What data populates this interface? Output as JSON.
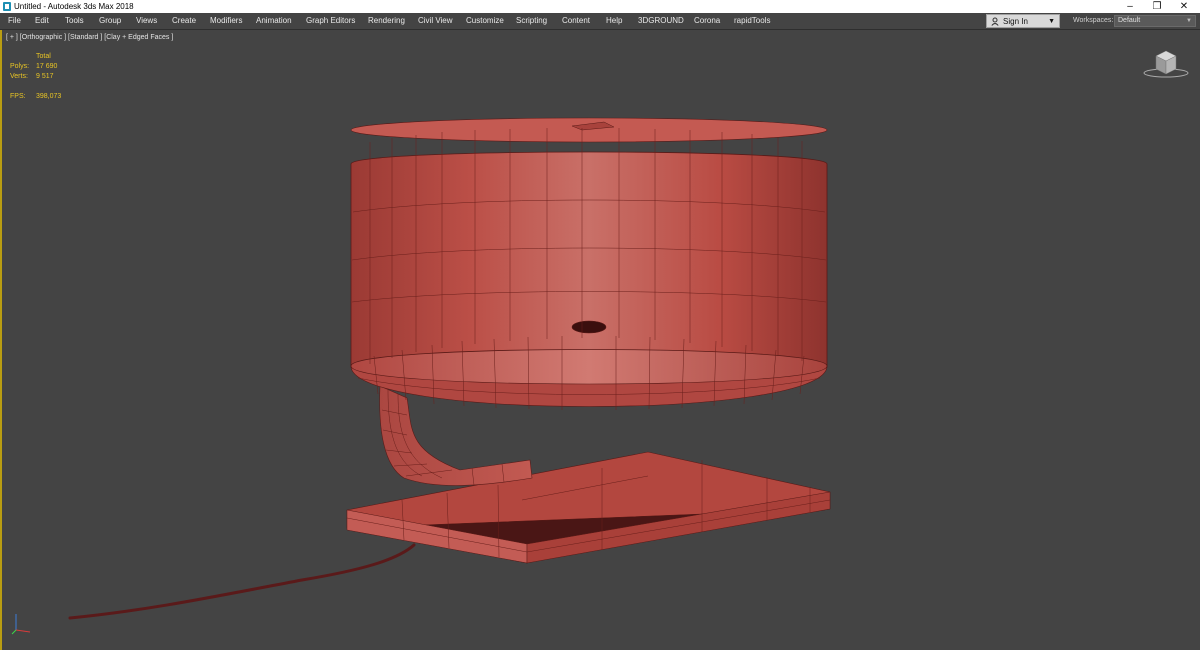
{
  "window": {
    "title": "Untitled - Autodesk 3ds Max 2018",
    "controls": [
      "minimize-icon",
      "restore-icon",
      "close-icon"
    ]
  },
  "menu": {
    "items": [
      "File",
      "Edit",
      "Tools",
      "Group",
      "Views",
      "Create",
      "Modifiers",
      "Animation",
      "Graph Editors",
      "Rendering",
      "Civil View",
      "Customize",
      "Scripting",
      "Content",
      "Help",
      "3DGROUND",
      "Corona",
      "rapidTools"
    ]
  },
  "account": {
    "sign_in_label": "Sign In"
  },
  "workspaces": {
    "label": "Workspaces:",
    "value": "Default"
  },
  "viewport": {
    "label": "[ + ] [Orthographic ] [Standard ] [Clay + Edged Faces ]",
    "stats": {
      "header": "Total",
      "polys_label": "Polys:",
      "polys_value": "17 690",
      "verts_label": "Verts:",
      "verts_value": "9 517",
      "fps_label": "FPS:",
      "fps_value": "398,073"
    }
  },
  "colors": {
    "viewport_bg": "#444444",
    "stats_text": "#e9c524",
    "model_clay": "#c0504d",
    "active_border": "#b99d12"
  },
  "icons": {
    "app": "3ds-max-app-icon",
    "user": "user-icon",
    "viewcube": "viewcube-icon",
    "axis": "axis-tripod-icon"
  }
}
